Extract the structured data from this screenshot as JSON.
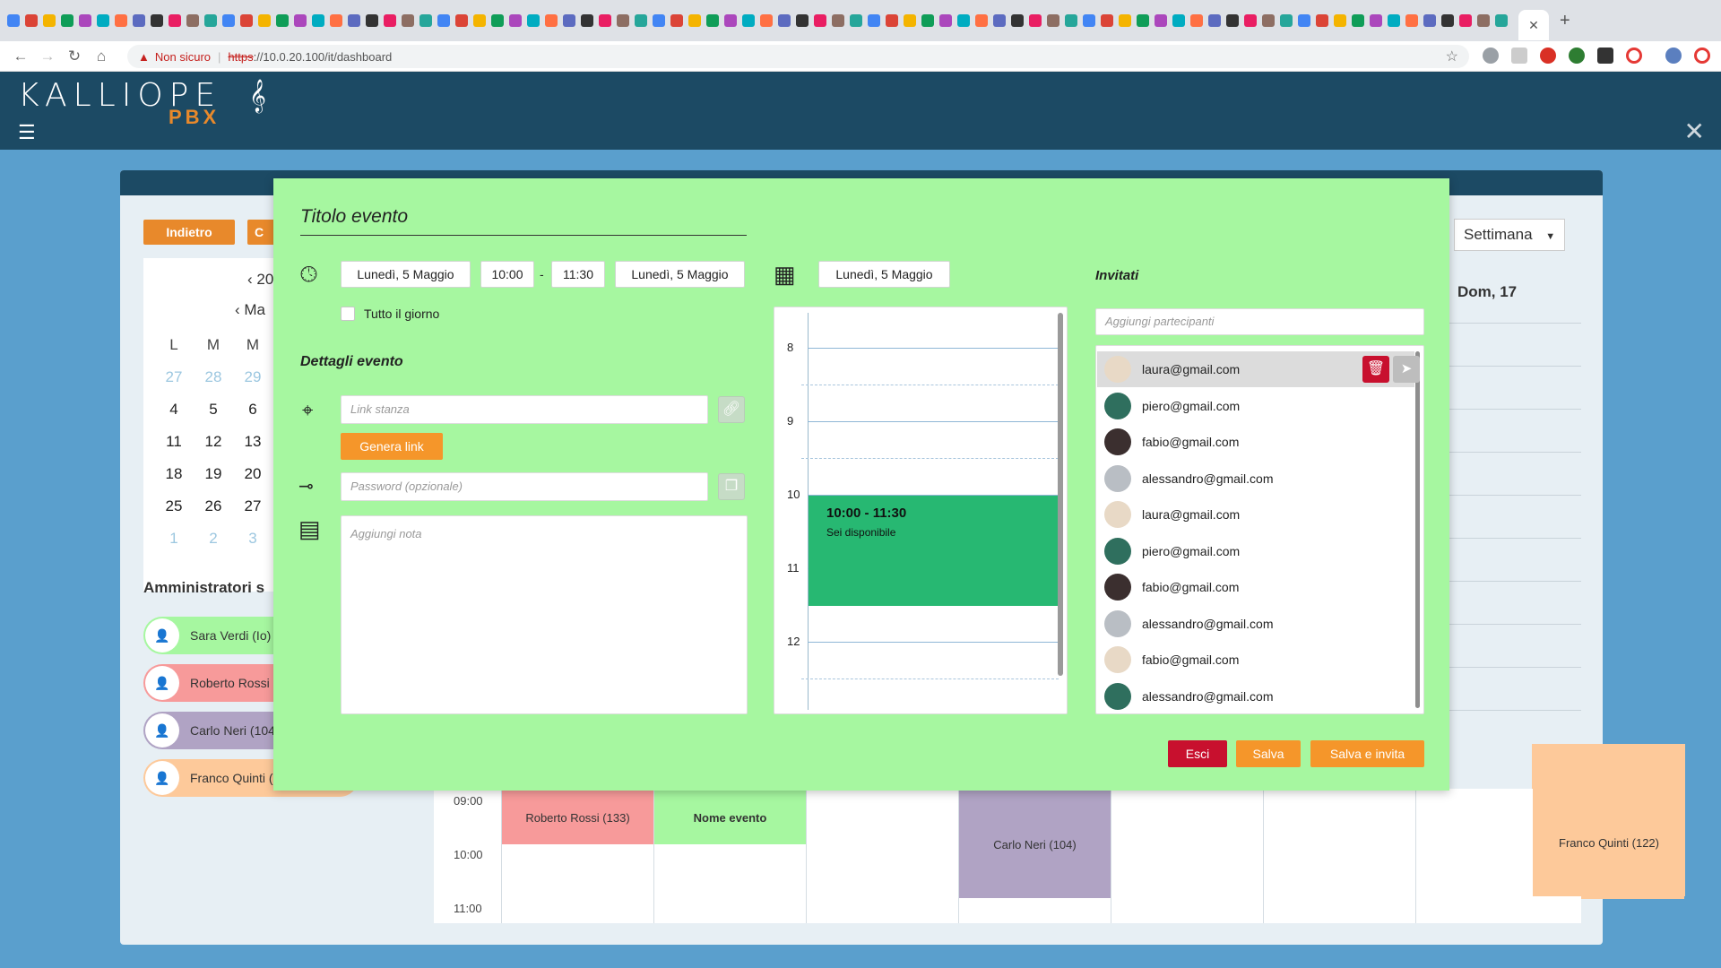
{
  "browser": {
    "insecure_label": "Non sicuro",
    "url_scheme": "https",
    "url_rest": "://10.0.20.100/it/dashboard",
    "active_tab_close": "✕",
    "new_tab": "+"
  },
  "app": {
    "logo_text": "KALLIOPE",
    "logo_sub": "PBX"
  },
  "background": {
    "back_button": "Indietro",
    "second_button": "C",
    "minical_year": "‹ 20",
    "minical_month": "‹ Ma",
    "minical_headers": [
      "L",
      "M",
      "M"
    ],
    "minical_rows": [
      [
        "27",
        "28",
        "29"
      ],
      [
        "4",
        "5",
        "6"
      ],
      [
        "11",
        "12",
        "13"
      ],
      [
        "18",
        "19",
        "20"
      ],
      [
        "25",
        "26",
        "27"
      ],
      [
        "1",
        "2",
        "3"
      ]
    ],
    "admins_title": "Amministratori s",
    "admins": [
      {
        "name": "Sara Verdi (Io)",
        "color": "#a6f7a0"
      },
      {
        "name": "Roberto Rossi (",
        "color": "#f79a9a"
      },
      {
        "name": "Carlo Neri (104",
        "color": "#b0a3c4"
      },
      {
        "name": "Franco Quinti (",
        "color": "#fdc99a"
      }
    ],
    "view_select": "Settimana",
    "day_header": "Dom, 17",
    "week_times": [
      "09:00",
      "10:00",
      "11:00"
    ],
    "week_events": {
      "roberto": "Roberto Rossi (133)",
      "nome_evento": "Nome evento",
      "carlo": "Carlo Neri (104)",
      "franco": "Franco Quinti (122)"
    }
  },
  "modal": {
    "title": "Titolo evento",
    "start_date": "Lunedì, 5 Maggio",
    "start_time": "10:00",
    "time_sep": "-",
    "end_time": "11:30",
    "end_date": "Lunedì, 5 Maggio",
    "all_day_label": "Tutto il giorno",
    "details_title": "Dettagli evento",
    "room_link_placeholder": "Link stanza",
    "generate_link": "Genera link",
    "password_placeholder": "Password (opzionale)",
    "note_placeholder": "Aggiungi nota",
    "calendar_date": "Lunedì, 5 Maggio",
    "timeline_hours": [
      "8",
      "9",
      "10",
      "11",
      "12"
    ],
    "event_time": "10:00 - 11:30",
    "event_status": "Sei disponibile",
    "invited_title": "Invitati",
    "add_participants_placeholder": "Aggiungi partecipanti",
    "invitees": [
      "laura@gmail.com",
      "piero@gmail.com",
      "fabio@gmail.com",
      "alessandro@gmail.com",
      "laura@gmail.com",
      "piero@gmail.com",
      "fabio@gmail.com",
      "alessandro@gmail.com",
      "fabio@gmail.com",
      "alessandro@gmail.com"
    ],
    "exit_button": "Esci",
    "save_button": "Salva",
    "save_invite_button": "Salva e invita"
  },
  "colors": {
    "modal_bg": "#a6f7a0",
    "header_bg": "#1c4a64",
    "accent_orange": "#f5962a",
    "danger_red": "#c8102e",
    "event_green": "#27b872"
  }
}
